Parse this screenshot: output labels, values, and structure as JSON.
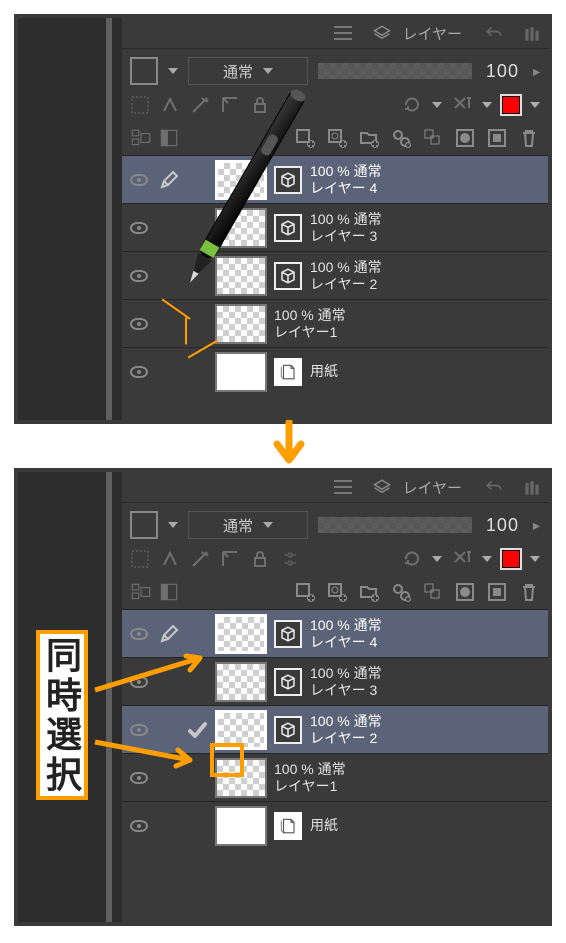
{
  "header": {
    "title": "レイヤー"
  },
  "blend": {
    "mode": "通常",
    "opacity": "100"
  },
  "toolbar": {
    "color": "#ff0000"
  },
  "layers_top": {
    "items": [
      {
        "opacity_label": "100 % 通常",
        "name": "レイヤー 4",
        "selected": true,
        "active_pencil": true,
        "checked": false,
        "indent": 1,
        "type": "raster"
      },
      {
        "opacity_label": "100 % 通常",
        "name": "レイヤー 3",
        "selected": false,
        "active_pencil": false,
        "checked": false,
        "indent": 1,
        "type": "raster"
      },
      {
        "opacity_label": "100 % 通常",
        "name": "レイヤー 2",
        "selected": false,
        "active_pencil": false,
        "checked": false,
        "indent": 1,
        "type": "raster"
      },
      {
        "opacity_label": "100 % 通常",
        "name": "レイヤー1",
        "selected": false,
        "active_pencil": false,
        "checked": false,
        "indent": 0,
        "type": "raster"
      },
      {
        "opacity_label": "",
        "name": "用紙",
        "selected": false,
        "active_pencil": false,
        "checked": false,
        "indent": 0,
        "type": "paper"
      }
    ]
  },
  "layers_bottom": {
    "items": [
      {
        "opacity_label": "100 % 通常",
        "name": "レイヤー 4",
        "selected": true,
        "active_pencil": true,
        "checked": false,
        "indent": 1,
        "type": "raster"
      },
      {
        "opacity_label": "100 % 通常",
        "name": "レイヤー 3",
        "selected": false,
        "active_pencil": false,
        "checked": false,
        "indent": 1,
        "type": "raster"
      },
      {
        "opacity_label": "100 % 通常",
        "name": "レイヤー 2",
        "selected": true,
        "active_pencil": false,
        "checked": true,
        "indent": 1,
        "type": "raster"
      },
      {
        "opacity_label": "100 % 通常",
        "name": "レイヤー1",
        "selected": false,
        "active_pencil": false,
        "checked": false,
        "indent": 0,
        "type": "raster"
      },
      {
        "opacity_label": "",
        "name": "用紙",
        "selected": false,
        "active_pencil": false,
        "checked": false,
        "indent": 0,
        "type": "paper"
      }
    ]
  },
  "annotation": {
    "label": "同時選択"
  }
}
